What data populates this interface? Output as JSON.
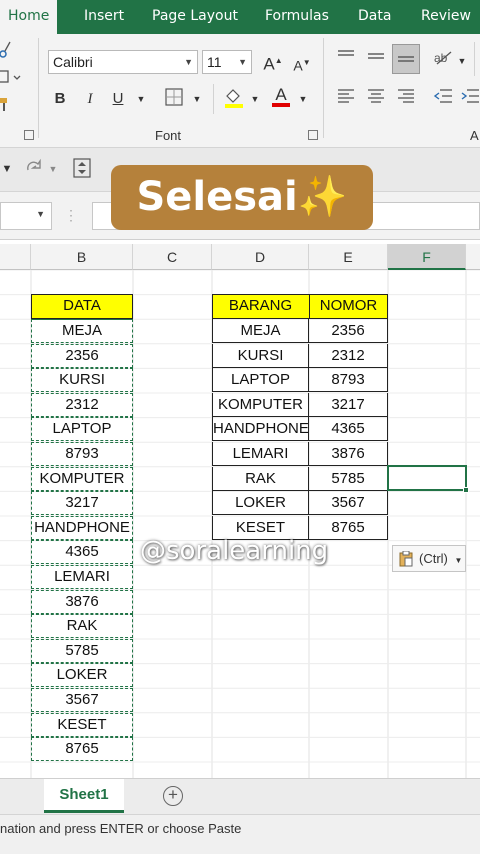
{
  "ribbon_tabs": [
    "Home",
    "Insert",
    "Page Layout",
    "Formulas",
    "Data",
    "Review"
  ],
  "font": {
    "name": "Calibri",
    "size": "11",
    "group_label": "Font",
    "bold": "B",
    "italic": "I",
    "underline": "U",
    "grow": "A",
    "shrink": "A",
    "font_color": "A"
  },
  "overlay_title": "Selesai✨",
  "columns": [
    "B",
    "C",
    "D",
    "E",
    "F"
  ],
  "selected_column": "F",
  "column_b": {
    "header": "DATA",
    "values": [
      "MEJA",
      "2356",
      "KURSI",
      "2312",
      "LAPTOP",
      "8793",
      "KOMPUTER",
      "3217",
      "HANDPHONE",
      "4365",
      "LEMARI",
      "3876",
      "RAK",
      "5785",
      "LOKER",
      "3567",
      "KESET",
      "8765"
    ]
  },
  "table": {
    "headers": [
      "BARANG",
      "NOMOR"
    ],
    "rows": [
      [
        "MEJA",
        "2356"
      ],
      [
        "KURSI",
        "2312"
      ],
      [
        "LAPTOP",
        "8793"
      ],
      [
        "KOMPUTER",
        "3217"
      ],
      [
        "HANDPHONE",
        "4365"
      ],
      [
        "LEMARI",
        "3876"
      ],
      [
        "RAK",
        "5785"
      ],
      [
        "LOKER",
        "3567"
      ],
      [
        "KESET",
        "8765"
      ]
    ]
  },
  "watermark": "@soralearning",
  "paste_options": "(Ctrl)",
  "sheet_tab": "Sheet1",
  "add_sheet": "+",
  "status_text": "nation and press ENTER or choose Paste",
  "colors": {
    "excel_green": "#217346",
    "header_fill": "#ffff00",
    "banner": "#b5813b"
  }
}
